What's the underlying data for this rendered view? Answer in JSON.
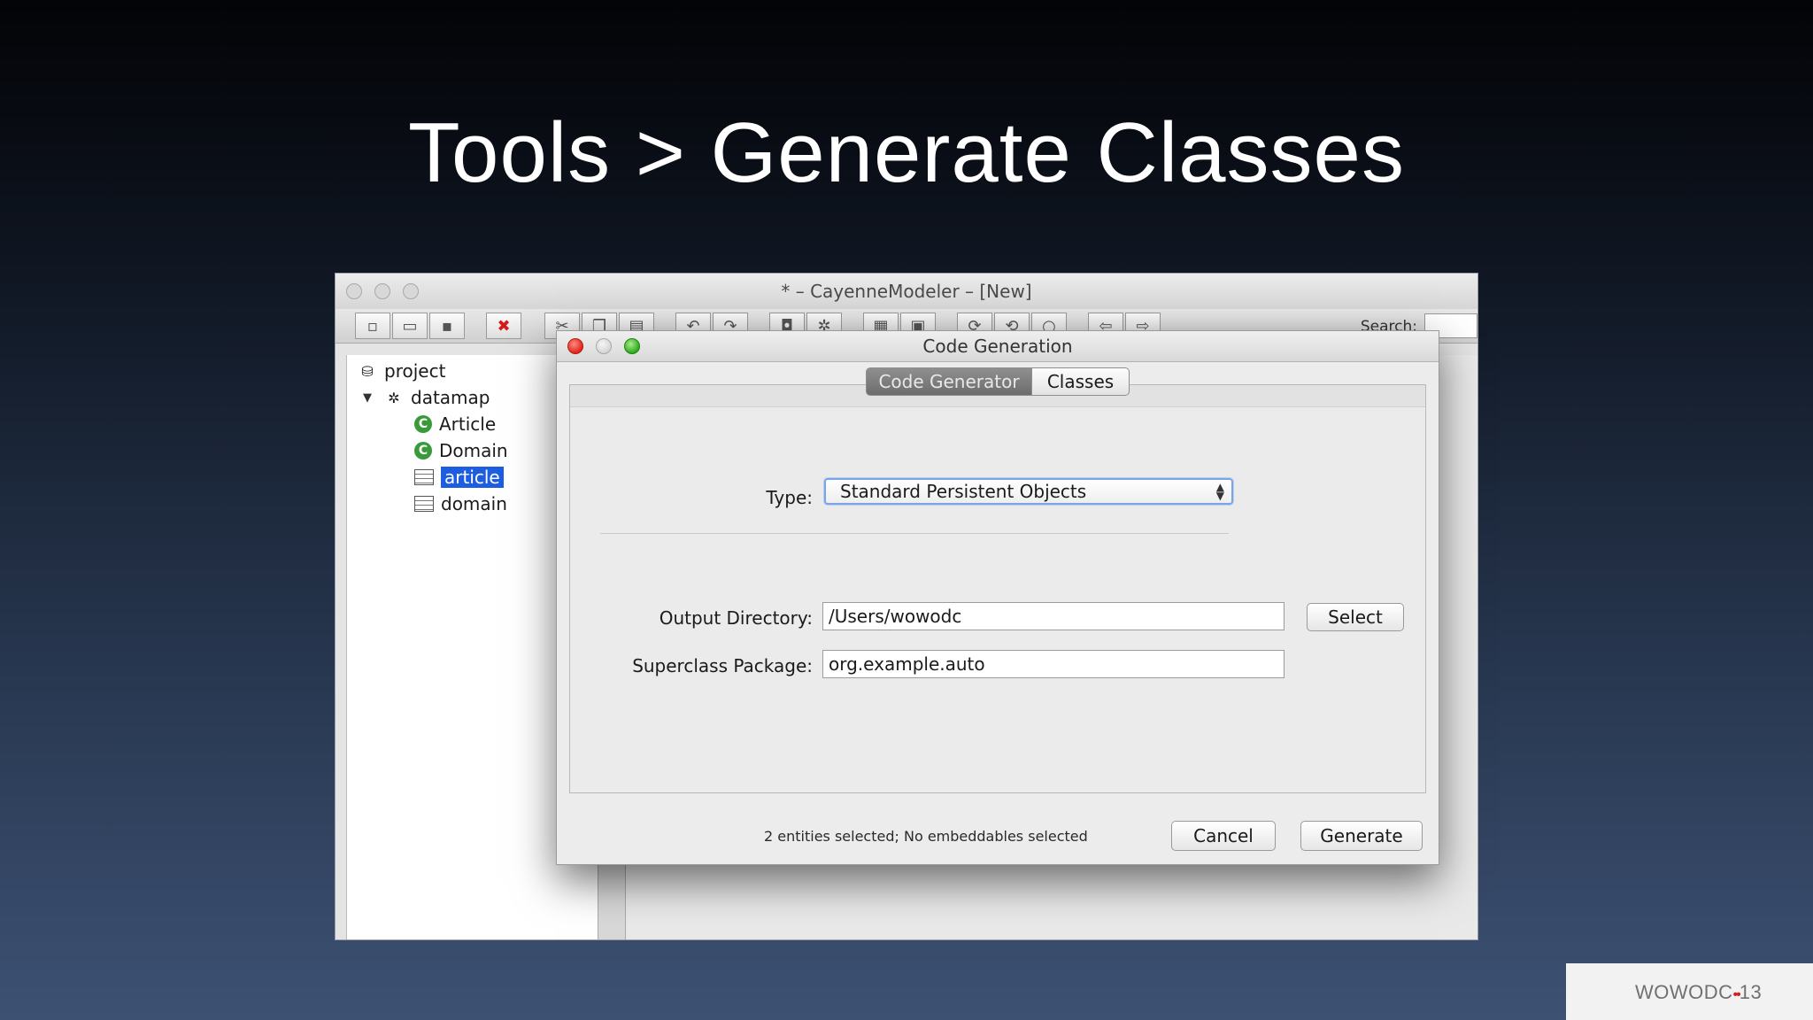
{
  "slide": {
    "title": "Tools > Generate Classes"
  },
  "main_window": {
    "title": "* – CayenneModeler – [New]",
    "search_label": "Search:",
    "tree": [
      {
        "label": "project",
        "icon": "database-icon"
      },
      {
        "label": "datamap",
        "icon": "datamap-icon",
        "expanded": true
      },
      {
        "label": "Article",
        "icon": "class-icon"
      },
      {
        "label": "Domain",
        "icon": "class-icon"
      },
      {
        "label": "article",
        "icon": "table-icon",
        "selected": true
      },
      {
        "label": "domain",
        "icon": "table-icon"
      }
    ]
  },
  "dialog": {
    "title": "Code Generation",
    "tabs": [
      {
        "label": "Code Generator",
        "active": true
      },
      {
        "label": "Classes",
        "active": false
      }
    ],
    "type_label": "Type:",
    "type_value": "Standard Persistent Objects",
    "output_dir_label": "Output Directory:",
    "output_dir_value": "/Users/wowodc",
    "select_button": "Select",
    "superclass_label": "Superclass Package:",
    "superclass_value": "org.example.auto",
    "status": "2 entities selected; No embeddables selected",
    "cancel_button": "Cancel",
    "generate_button": "Generate"
  },
  "footer": {
    "logo_left": "WOWODC",
    "logo_dots": "••",
    "logo_right": "13"
  },
  "colors": {
    "selection": "#1d5ee0",
    "close_button": "#e0261a",
    "zoom_button": "#2eaa1e",
    "logo_dots": "#d22020"
  }
}
